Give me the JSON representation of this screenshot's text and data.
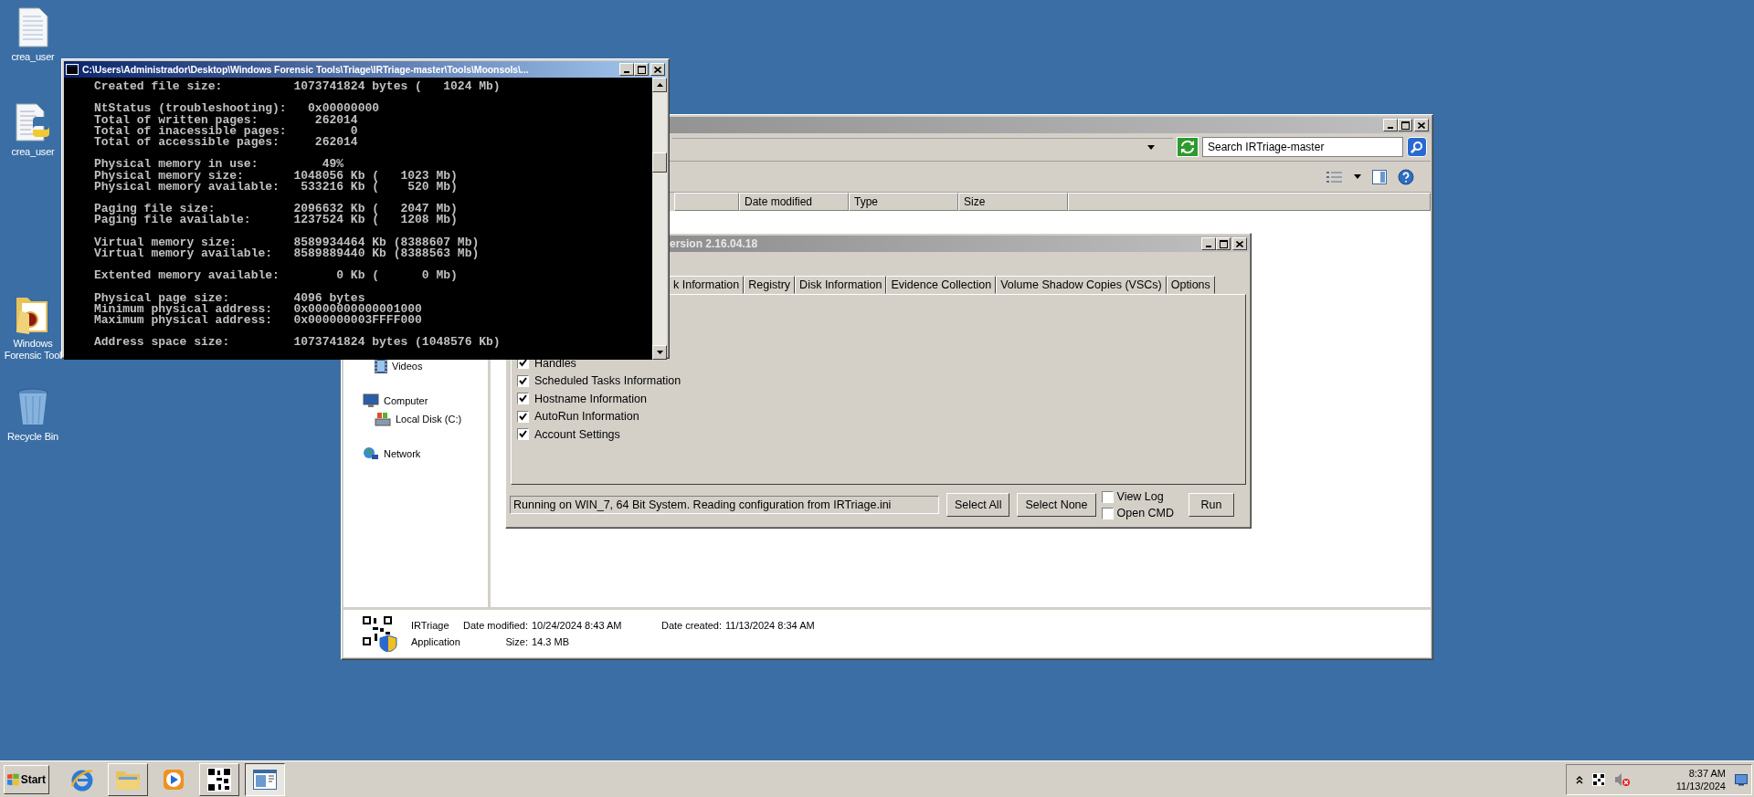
{
  "desktop_icons": [
    {
      "label": "crea_user",
      "kind": "text-file"
    },
    {
      "label": "crea_user",
      "kind": "python-file"
    },
    {
      "label": "Windows Forensic Tool",
      "kind": "folder"
    },
    {
      "label": "Recycle Bin",
      "kind": "recycle-bin"
    }
  ],
  "explorer": {
    "search": {
      "placeholder": "Search IRTriage-master"
    },
    "columns": [
      "Date modified",
      "Type",
      "Size"
    ],
    "nav_items": [
      {
        "label": "Videos",
        "kind": "video"
      },
      {
        "label": "Computer",
        "kind": "computer",
        "children": [
          {
            "label": "Local Disk (C:)",
            "kind": "disk"
          }
        ]
      },
      {
        "label": "Network",
        "kind": "network"
      }
    ],
    "details": {
      "name": "IRTriage",
      "type": "Application",
      "fields": [
        {
          "label": "Date modified:",
          "value": "10/24/2024 8:43 AM"
        },
        {
          "label": "Date created:",
          "value": "11/13/2024 8:34 AM"
        },
        {
          "label": "Size:",
          "value": "14.3 MB"
        }
      ]
    }
  },
  "irtriage": {
    "title": "ersion 2.16.04.18",
    "tabs": [
      {
        "label": "k Information",
        "selected": false
      },
      {
        "label": "Registry",
        "selected": false
      },
      {
        "label": "Disk Information",
        "selected": false
      },
      {
        "label": "Evidence Collection",
        "selected": false
      },
      {
        "label": "Volume Shadow Copies (VSCs)",
        "selected": false
      },
      {
        "label": "Options",
        "selected": false
      }
    ],
    "options": [
      {
        "label": "Handles",
        "checked": true
      },
      {
        "label": "Scheduled Tasks Information",
        "checked": true
      },
      {
        "label": "Hostname Information",
        "checked": true
      },
      {
        "label": "AutoRun Information",
        "checked": true
      },
      {
        "label": "Account Settings",
        "checked": true
      }
    ],
    "status": "Running on WIN_7, 64 Bit System. Reading configuration from IRTriage.ini",
    "buttons": [
      "Select All",
      "Select None"
    ],
    "toggles": [
      {
        "label": "View Log",
        "checked": false
      },
      {
        "label": "Open CMD",
        "checked": false
      }
    ],
    "run_button": "Run"
  },
  "console": {
    "title": "C:\\Users\\Administrador\\Desktop\\Windows Forensic Tools\\Triage\\IRTriage-master\\Tools\\Moonsols\\...",
    "blocks": [
      [
        "Created file size:          1073741824 bytes (   1024 Mb)"
      ],
      [
        "NtStatus (troubleshooting):   0x00000000",
        "Total of written pages:        262014",
        "Total of inacessible pages:         0",
        "Total of accessible pages:     262014"
      ],
      [
        "Physical memory in use:         49%",
        "Physical memory size:       1048056 Kb (   1023 Mb)",
        "Physical memory available:   533216 Kb (    520 Mb)"
      ],
      [
        "Paging file size:           2096632 Kb (   2047 Mb)",
        "Paging file available:      1237524 Kb (   1208 Mb)"
      ],
      [
        "Virtual memory size:        8589934464 Kb (8388607 Mb)",
        "Virtual memory available:   8589889440 Kb (8388563 Mb)"
      ],
      [
        "Extented memory available:        0 Kb (      0 Mb)"
      ],
      [
        "Physical page size:         4096 bytes",
        "Minimum physical address:   0x0000000000001000",
        "Maximum physical address:   0x000000003FFFF000"
      ],
      [
        "Address space size:         1073741824 bytes (1048576 Kb)"
      ]
    ]
  },
  "taskbar": {
    "start": "Start",
    "apps": [
      {
        "kind": "browser",
        "running": false,
        "selected": false
      },
      {
        "kind": "folder",
        "running": true,
        "selected": false
      },
      {
        "kind": "media",
        "running": false,
        "selected": false
      },
      {
        "kind": "qr",
        "running": true,
        "selected": false
      },
      {
        "kind": "console",
        "running": true,
        "selected": true
      }
    ],
    "clock": {
      "time": "8:37 AM",
      "date": "11/13/2024"
    }
  }
}
